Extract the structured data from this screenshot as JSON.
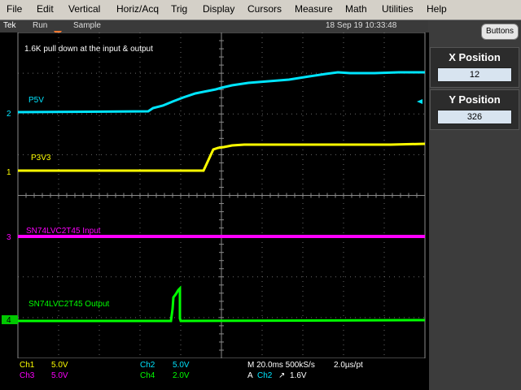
{
  "menu": [
    "File",
    "Edit",
    "Vertical",
    "Horiz/Acq",
    "Trig",
    "Display",
    "Cursors",
    "Measure",
    "Math",
    "Utilities",
    "Help"
  ],
  "status": {
    "brand": "Tek",
    "run": "Run",
    "mode": "Sample",
    "datetime": "18 Sep 19 10:33:48"
  },
  "panel": {
    "buttons_label": "Buttons",
    "x_position_title": "X Position",
    "x_position_value": "12",
    "y_position_title": "Y Position",
    "y_position_value": "326"
  },
  "annotation": "1.6K pull down at the input & output",
  "traces": {
    "ch1": {
      "label": "P3V3",
      "marker": "1",
      "color": "#ffff00"
    },
    "ch2": {
      "label": "P5V",
      "marker": "2",
      "color": "#00e5ff"
    },
    "ch3": {
      "label": "SN74LVC2T45 Input",
      "marker": "3",
      "color": "#ff00ff"
    },
    "ch4": {
      "label": "SN74LVC2T45 Output",
      "marker": "4",
      "color": "#00ff00"
    }
  },
  "readout": {
    "ch1_name": "Ch1",
    "ch1_scale": "5.0V",
    "ch2_name": "Ch2",
    "ch2_scale": "5.0V",
    "ch3_name": "Ch3",
    "ch3_scale": "5.0V",
    "ch4_name": "Ch4",
    "ch4_scale": "2.0V",
    "timebase": "M 20.0ms 500kS/s",
    "sample_interval": "2.0µs/pt",
    "trigger_prefix": "A",
    "trigger_channel": "Ch2",
    "trigger_level": "1.6V"
  }
}
